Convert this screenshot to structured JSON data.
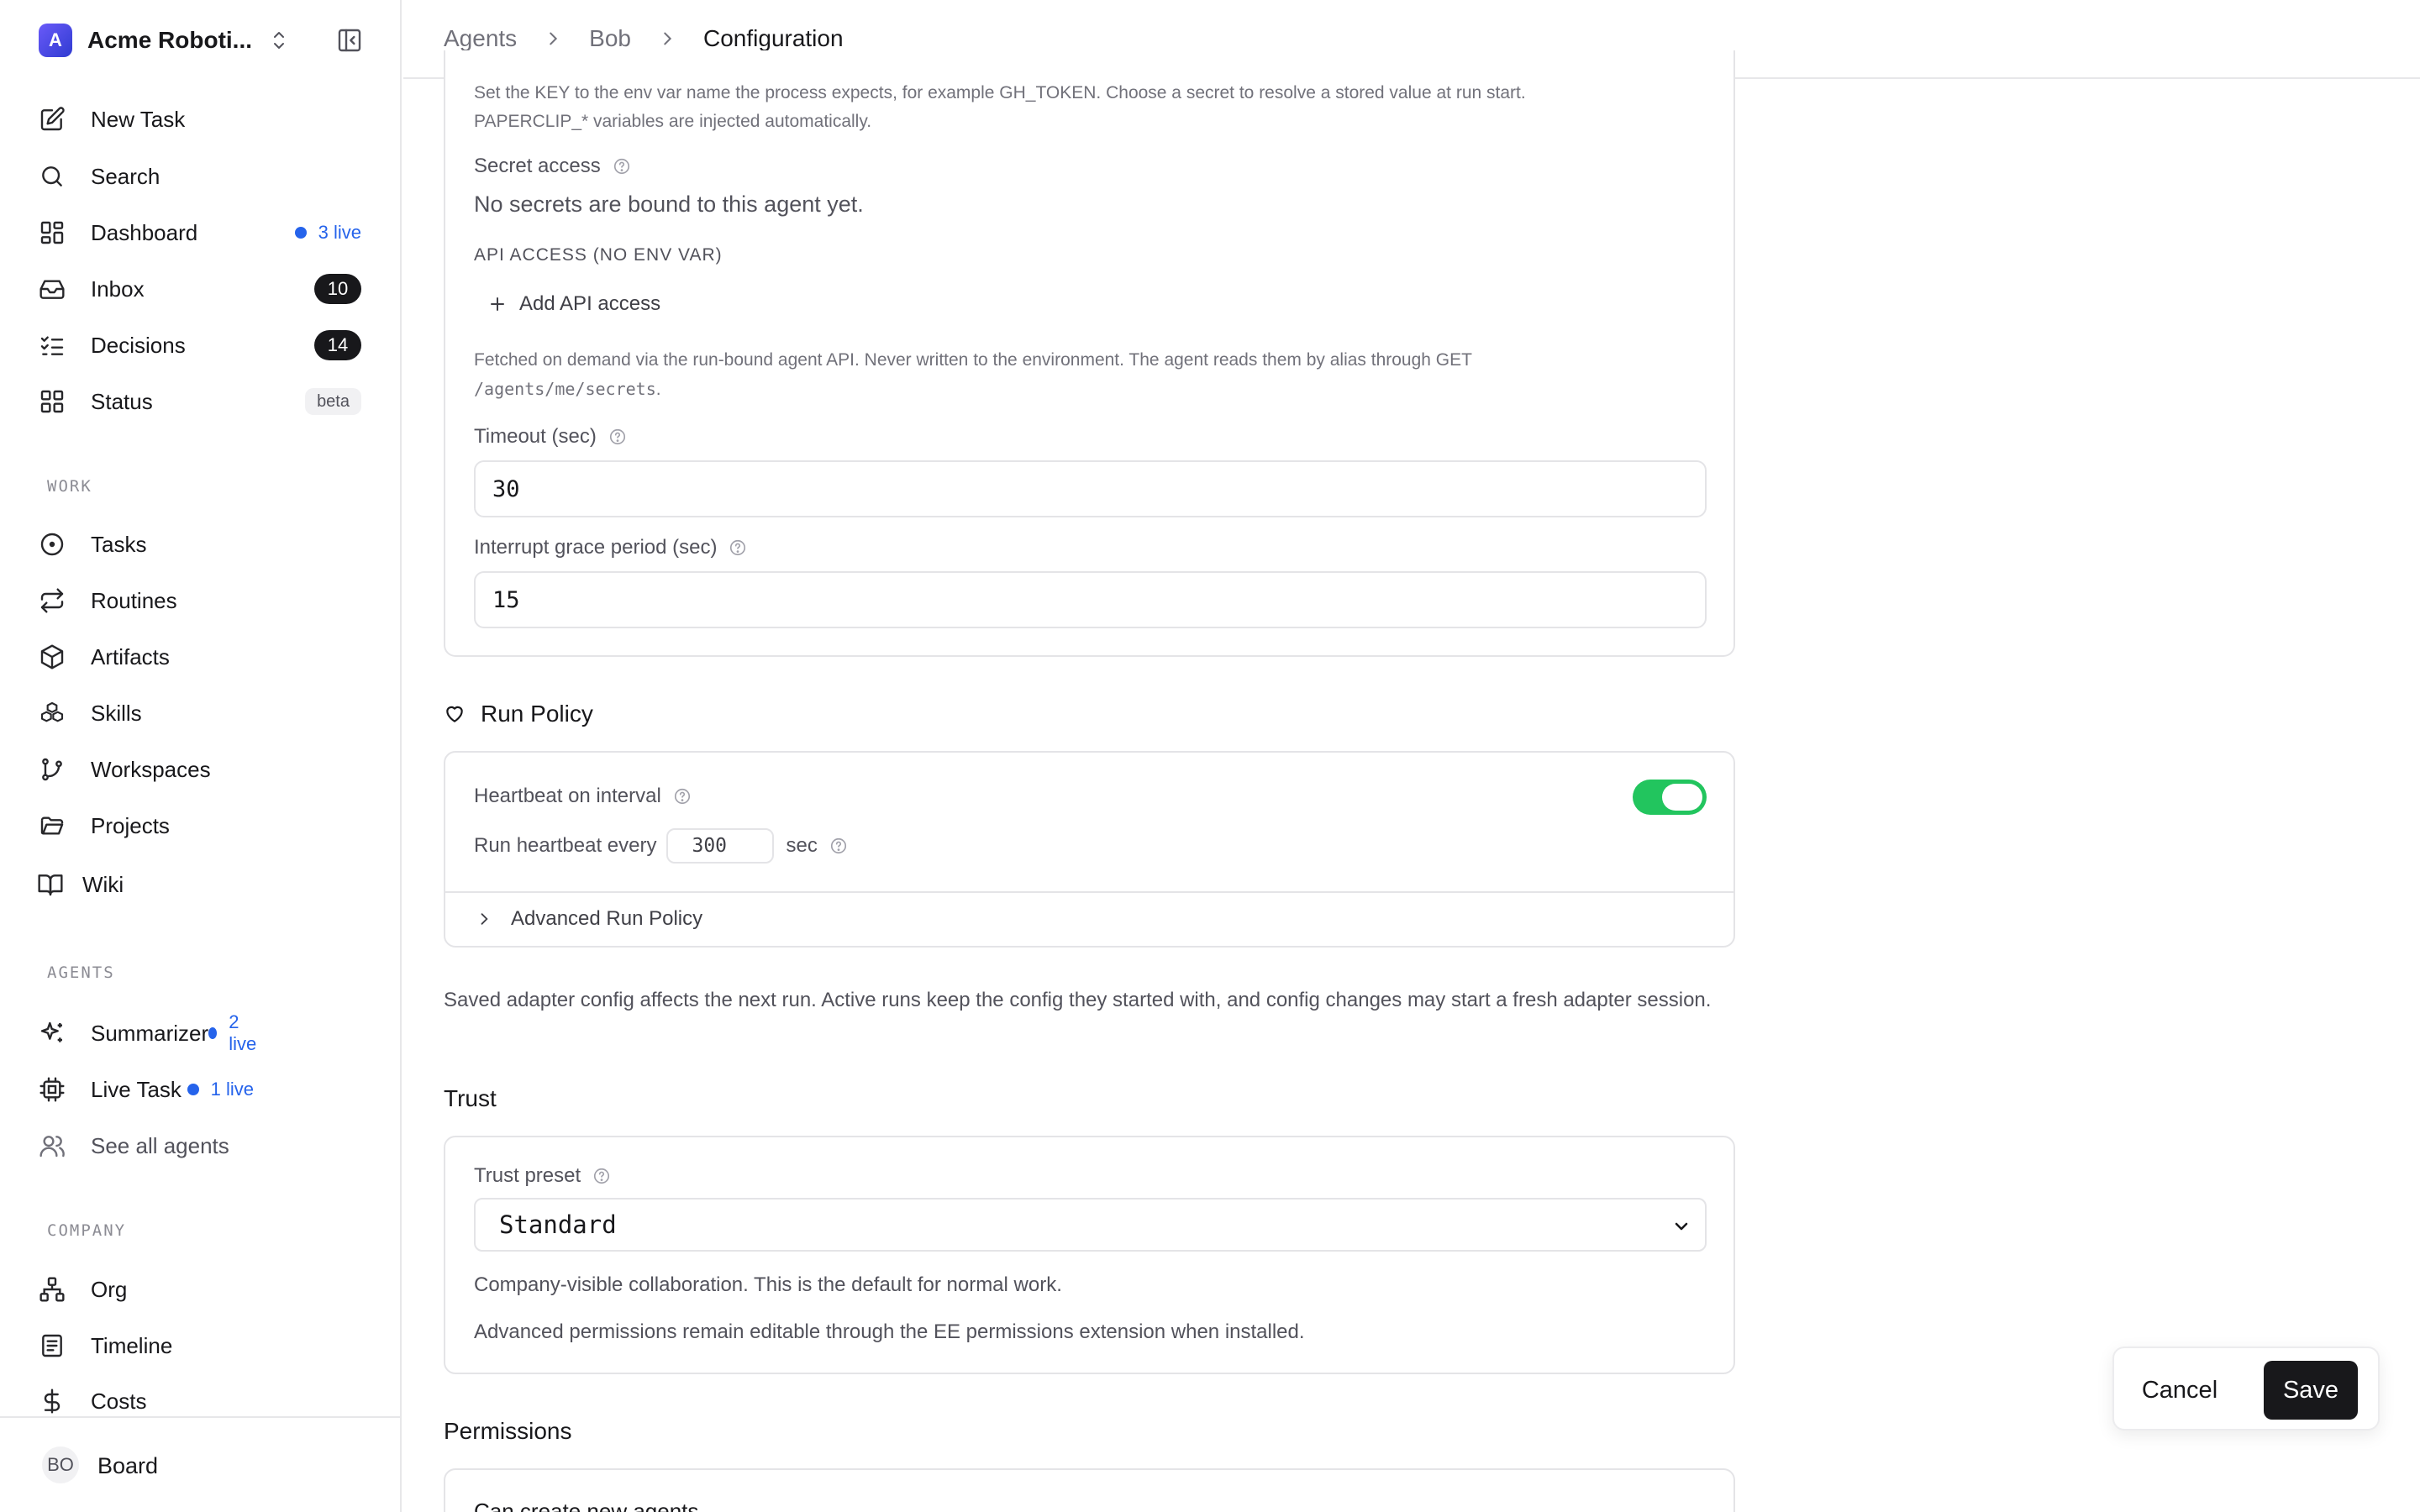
{
  "sidebar": {
    "company": {
      "initial": "A",
      "name": "Acme Roboti..."
    },
    "main_items": [
      {
        "label": "New Task"
      },
      {
        "label": "Search"
      },
      {
        "label": "Dashboard",
        "live": "3 live"
      },
      {
        "label": "Inbox",
        "count": "10"
      },
      {
        "label": "Decisions",
        "count": "14"
      },
      {
        "label": "Status",
        "tag": "beta"
      }
    ],
    "work_label": "WORK",
    "work_items": [
      {
        "label": "Tasks"
      },
      {
        "label": "Routines"
      },
      {
        "label": "Artifacts"
      },
      {
        "label": "Skills"
      },
      {
        "label": "Workspaces"
      },
      {
        "label": "Projects"
      },
      {
        "label": "Wiki"
      }
    ],
    "agents_label": "AGENTS",
    "agent_items": [
      {
        "label": "Summarizer",
        "live": "2 live"
      },
      {
        "label": "Live Task",
        "live": "1 live"
      },
      {
        "label": "See all agents"
      }
    ],
    "company_label": "COMPANY",
    "company_items": [
      {
        "label": "Org"
      },
      {
        "label": "Timeline"
      },
      {
        "label": "Costs"
      }
    ],
    "user": {
      "initials": "BO",
      "name": "Board"
    }
  },
  "breadcrumb": [
    "Agents",
    "Bob",
    "Configuration"
  ],
  "env": {
    "hint_line1": "Set the KEY to the env var name the process expects, for example GH_TOKEN. Choose a secret to resolve a stored value at run start.",
    "hint_line2": "PAPERCLIP_* variables are injected automatically.",
    "secret_access_label": "Secret access",
    "secret_access_empty": "No secrets are bound to this agent yet.",
    "api_access_label": "API ACCESS (NO ENV VAR)",
    "add_api_access": "Add API access",
    "api_hint_line1": "Fetched on demand via the run-bound agent API. Never written to the environment. The agent reads them by alias through GET",
    "api_hint_path": "/agents/me/secrets",
    "api_hint_end": ".",
    "timeout_label": "Timeout (sec)",
    "timeout_value": "30",
    "grace_label": "Interrupt grace period (sec)",
    "grace_value": "15"
  },
  "run_policy": {
    "title": "Run Policy",
    "heartbeat_label": "Heartbeat on interval",
    "heartbeat_enabled": true,
    "every_prefix": "Run heartbeat every",
    "every_value": "300",
    "every_suffix": "sec",
    "advanced_label": "Advanced Run Policy"
  },
  "adapter_note": "Saved adapter config affects the next run. Active runs keep the config they started with, and config changes may start a fresh adapter session.",
  "trust": {
    "title": "Trust",
    "preset_label": "Trust preset",
    "preset_value": "Standard",
    "preset_description": "Company-visible collaboration. This is the default for normal work.",
    "advanced_note": "Advanced permissions remain editable through the EE permissions extension when installed."
  },
  "permissions": {
    "title": "Permissions",
    "first_item": "Can create new agents"
  },
  "actions": {
    "cancel": "Cancel",
    "save": "Save"
  },
  "colors": {
    "toggle_on": "#22c55e",
    "live": "#2563eb",
    "primary": "#18181b"
  }
}
